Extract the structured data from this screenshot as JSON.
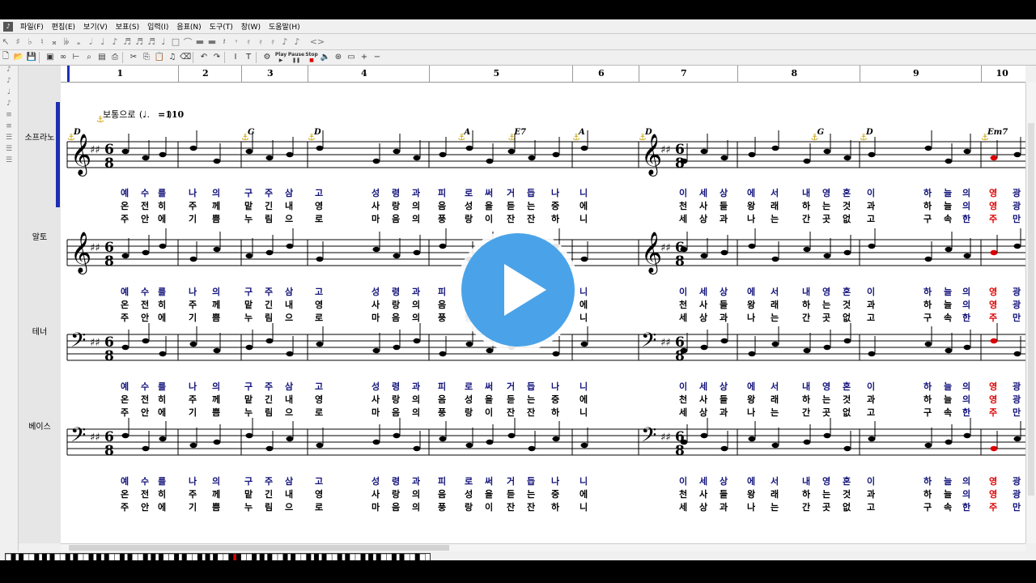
{
  "menu": [
    "파일(F)",
    "편집(E)",
    "보기(V)",
    "보표(S)",
    "입력(I)",
    "음표(N)",
    "도구(T)",
    "창(W)",
    "도움말(H)"
  ],
  "toolbar2": {
    "play": "Play",
    "pause": "Pause",
    "stop": "Stop"
  },
  "measures": [
    "1",
    "2",
    "3",
    "4",
    "5",
    "6",
    "7",
    "8",
    "9",
    "10"
  ],
  "tempo": {
    "text": "보통으로",
    "bpm": "=110"
  },
  "chords": [
    {
      "label": "D",
      "measure": 1,
      "offset": 0
    },
    {
      "label": "G",
      "measure": 3,
      "offset": 0
    },
    {
      "label": "D",
      "measure": 4,
      "offset": 0
    },
    {
      "label": "A",
      "measure": 5,
      "offset": 0.2
    },
    {
      "label": "E7",
      "measure": 5,
      "offset": 0.55
    },
    {
      "label": "A",
      "measure": 6,
      "offset": 0
    },
    {
      "label": "D",
      "measure": 7,
      "offset": 0
    },
    {
      "label": "G",
      "measure": 8,
      "offset": 0.6
    },
    {
      "label": "D",
      "measure": 9,
      "offset": 0
    },
    {
      "label": "Em7",
      "measure": 10,
      "offset": 0
    }
  ],
  "tracks": [
    {
      "name": "소프라노",
      "clef": "treble"
    },
    {
      "name": "알토",
      "clef": "treble"
    },
    {
      "name": "테너",
      "clef": "bass"
    },
    {
      "name": "베이스",
      "clef": "bass"
    }
  ],
  "time_signature": "6/8",
  "lyrics": [
    [
      "예",
      "수",
      "를",
      "나",
      "의",
      "구",
      "주",
      "삼",
      "고",
      "성",
      "령",
      "과",
      "피",
      "로",
      "써",
      "거",
      "듭",
      "나",
      "니",
      "이",
      "세",
      "상",
      "에",
      "서",
      "내",
      "영",
      "혼",
      "이",
      "하",
      "늘",
      "의",
      "영",
      "광"
    ],
    [
      "온",
      "전",
      "히",
      "주",
      "께",
      "맡",
      "긴",
      "내",
      "영",
      "사",
      "랑",
      "의",
      "음",
      "성",
      "을",
      "듣",
      "는",
      "중",
      "에",
      "천",
      "사",
      "들",
      "왕",
      "래",
      "하",
      "는",
      "것",
      "과",
      "하",
      "늘",
      "의",
      "영",
      "광"
    ],
    [
      "주",
      "안",
      "에",
      "기",
      "쁨",
      "누",
      "림",
      "으",
      "로",
      "마",
      "음",
      "의",
      "풍",
      "랑",
      "이",
      "잔",
      "잔",
      "하",
      "니",
      "세",
      "상",
      "과",
      "나",
      "는",
      "간",
      "곳",
      "없",
      "고",
      "구",
      "속",
      "한",
      "주",
      "만"
    ]
  ],
  "play_button": {
    "label": "play-video"
  }
}
